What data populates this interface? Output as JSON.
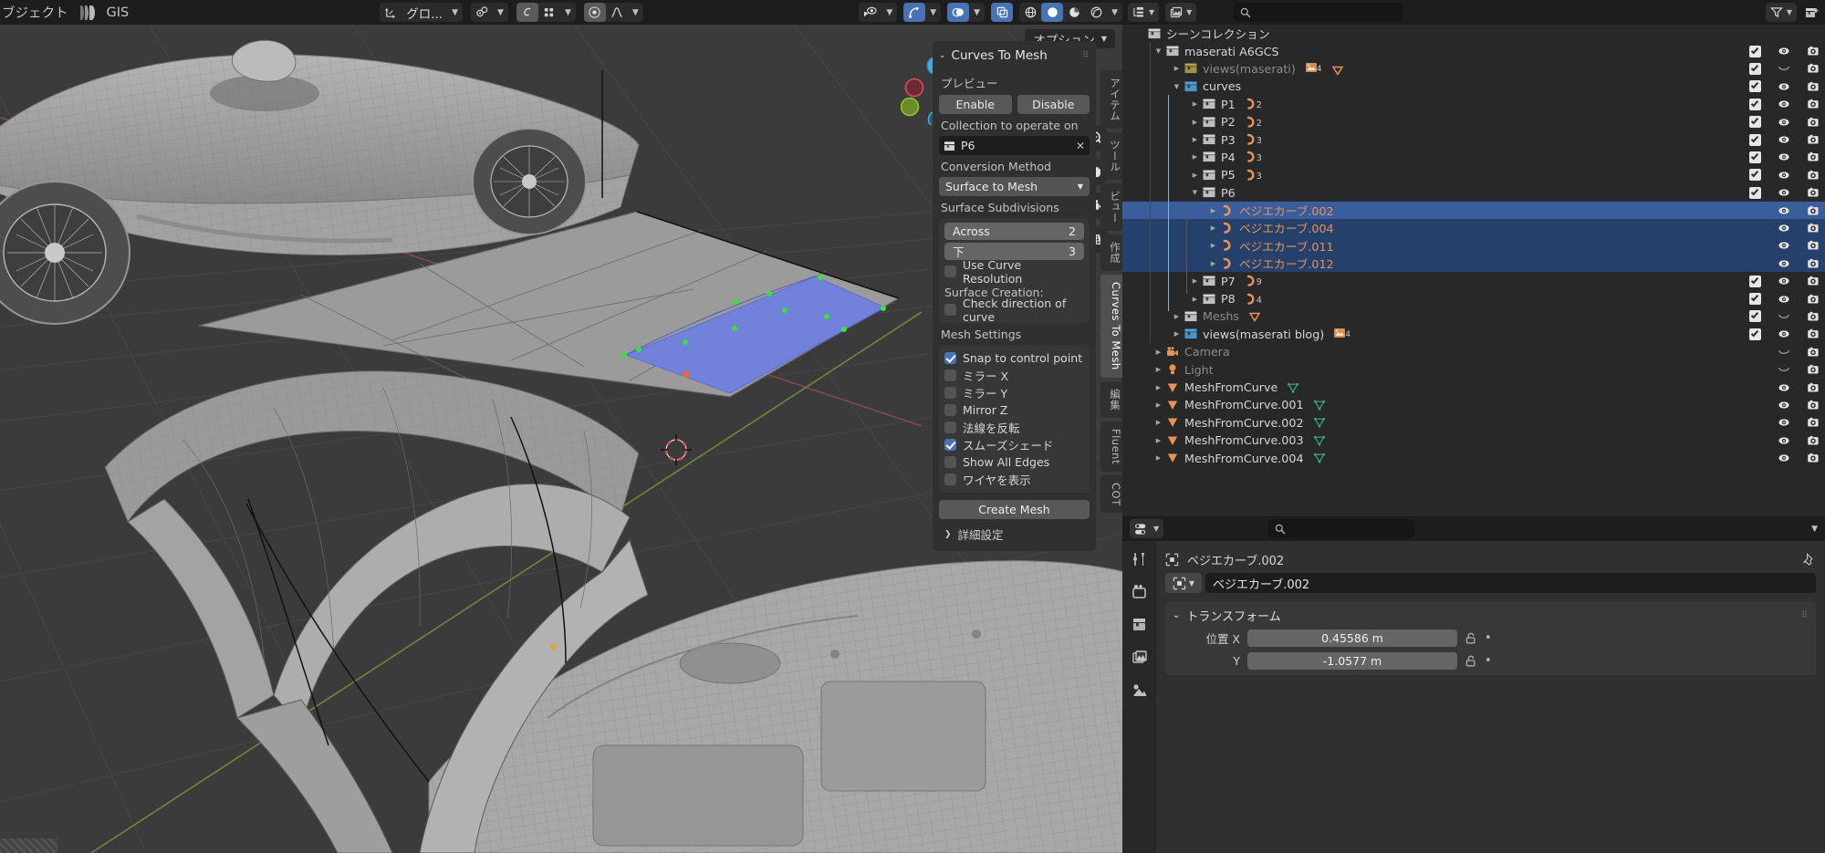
{
  "topbar": {
    "menu_object": "ブジェクト",
    "gis_label": "GIS",
    "transform_orientation": "グロ...",
    "options_label": "オプション"
  },
  "viewport": {
    "gizmo_axes": [
      "Z",
      "Y",
      "X"
    ],
    "tools": [
      "zoom-icon",
      "hand-icon",
      "camera-icon",
      "grid-icon"
    ]
  },
  "npanel": {
    "title": "Curves To Mesh",
    "preview_label": "プレビュー",
    "enable": "Enable",
    "disable": "Disable",
    "collection_label": "Collection to operate on",
    "collection_value": "P6",
    "conversion_label": "Conversion Method",
    "conversion_value": "Surface to Mesh",
    "subdiv_label": "Surface Subdivisions",
    "across_label": "Across",
    "across_value": "2",
    "down_label": "下",
    "down_value": "3",
    "use_curve_res": "Use Curve Resolution",
    "surface_creation_label": "Surface Creation:",
    "check_direction": "Check direction of curve",
    "mesh_settings_label": "Mesh Settings",
    "snap_control_point": "Snap to control point",
    "mirror_x": "ミラー X",
    "mirror_y": "ミラー Y",
    "mirror_z": "Mirror Z",
    "flip_normals": "法線を反転",
    "smooth_shade": "スムーズシェード",
    "show_all_edges": "Show All Edges",
    "show_wire": "ワイヤを表示",
    "create_mesh": "Create Mesh",
    "advanced": "詳細設定",
    "checks": {
      "use_curve_res": false,
      "check_direction": false,
      "snap_control_point": true,
      "mirror_x": false,
      "mirror_y": false,
      "mirror_z": false,
      "flip_normals": false,
      "smooth_shade": true,
      "show_all_edges": false,
      "show_wire": false
    }
  },
  "vtabs": [
    {
      "label": "アイテム",
      "active": false
    },
    {
      "label": "ツール",
      "active": false
    },
    {
      "label": "ビュー",
      "active": false
    },
    {
      "label": "作成",
      "active": false
    },
    {
      "label": "Curves To Mesh",
      "active": true
    },
    {
      "label": "編集",
      "active": false
    },
    {
      "label": "Fluent",
      "active": false
    },
    {
      "label": "COT",
      "active": false
    }
  ],
  "outliner": {
    "rows": [
      {
        "name": "シーンコレクション",
        "indent": 0,
        "tri": "",
        "icon": "collection",
        "icon_color": "#d3d3d3",
        "text_color": "normal",
        "check": null,
        "eye": null,
        "cam": null,
        "sel": false
      },
      {
        "name": "maserati A6GCS",
        "indent": 1,
        "tri": "down",
        "icon": "collection",
        "icon_color": "#d3d3d3",
        "text_color": "normal",
        "check": true,
        "eye": "open",
        "cam": true,
        "sel": false
      },
      {
        "name": "views(maserati)",
        "indent": 2,
        "tri": "right",
        "icon": "collection",
        "icon_color": "#b4a04a",
        "text_color": "dim",
        "check": true,
        "eye": "closed",
        "cam": true,
        "sel": false,
        "badges": [
          "image4",
          "mesh"
        ]
      },
      {
        "name": "curves",
        "indent": 2,
        "tri": "down",
        "icon": "collection",
        "icon_color": "#4aa5e0",
        "text_color": "normal",
        "check": true,
        "eye": "open",
        "cam": true,
        "sel": false
      },
      {
        "name": "P1",
        "indent": 3,
        "tri": "right",
        "icon": "collection",
        "icon_color": "#d3d3d3",
        "text_color": "normal",
        "check": true,
        "eye": "open",
        "cam": true,
        "sel": false,
        "curve_count": "2"
      },
      {
        "name": "P2",
        "indent": 3,
        "tri": "right",
        "icon": "collection",
        "icon_color": "#d3d3d3",
        "text_color": "normal",
        "check": true,
        "eye": "open",
        "cam": true,
        "sel": false,
        "curve_count": "2"
      },
      {
        "name": "P3",
        "indent": 3,
        "tri": "right",
        "icon": "collection",
        "icon_color": "#d3d3d3",
        "text_color": "normal",
        "check": true,
        "eye": "open",
        "cam": true,
        "sel": false,
        "curve_count": "3"
      },
      {
        "name": "P4",
        "indent": 3,
        "tri": "right",
        "icon": "collection",
        "icon_color": "#d3d3d3",
        "text_color": "normal",
        "check": true,
        "eye": "open",
        "cam": true,
        "sel": false,
        "curve_count": "3"
      },
      {
        "name": "P5",
        "indent": 3,
        "tri": "right",
        "icon": "collection",
        "icon_color": "#d3d3d3",
        "text_color": "normal",
        "check": true,
        "eye": "open",
        "cam": true,
        "sel": false,
        "curve_count": "3"
      },
      {
        "name": "P6",
        "indent": 3,
        "tri": "down",
        "icon": "collection",
        "icon_color": "#d3d3d3",
        "text_color": "normal",
        "check": true,
        "eye": "open",
        "cam": true,
        "sel": false
      },
      {
        "name": "ベジエカーブ.002",
        "indent": 4,
        "tri": "right",
        "icon": "curve",
        "icon_color": "#e79256",
        "text_color": "orange",
        "check": null,
        "eye": "open",
        "cam": true,
        "sel": "active"
      },
      {
        "name": "ベジエカーブ.004",
        "indent": 4,
        "tri": "right",
        "icon": "curve",
        "icon_color": "#e79256",
        "text_color": "orange",
        "check": null,
        "eye": "open",
        "cam": true,
        "sel": true
      },
      {
        "name": "ベジエカーブ.011",
        "indent": 4,
        "tri": "right",
        "icon": "curve",
        "icon_color": "#e79256",
        "text_color": "orange",
        "check": null,
        "eye": "open",
        "cam": true,
        "sel": true
      },
      {
        "name": "ベジエカーブ.012",
        "indent": 4,
        "tri": "right",
        "icon": "curve",
        "icon_color": "#e79256",
        "text_color": "orange",
        "check": null,
        "eye": "open",
        "cam": true,
        "sel": true
      },
      {
        "name": "P7",
        "indent": 3,
        "tri": "right",
        "icon": "collection",
        "icon_color": "#d3d3d3",
        "text_color": "normal",
        "check": true,
        "eye": "open",
        "cam": true,
        "sel": false,
        "curve_count": "9"
      },
      {
        "name": "P8",
        "indent": 3,
        "tri": "right",
        "icon": "collection",
        "icon_color": "#d3d3d3",
        "text_color": "normal",
        "check": true,
        "eye": "open",
        "cam": true,
        "sel": false,
        "curve_count": "4"
      },
      {
        "name": "Meshs",
        "indent": 2,
        "tri": "right",
        "icon": "collection",
        "icon_color": "#a munched",
        "text_color": "dim",
        "check": true,
        "eye": "closed",
        "cam": true,
        "sel": false,
        "badges": [
          "mesh"
        ]
      },
      {
        "name": "views(maserati blog)",
        "indent": 2,
        "tri": "right",
        "icon": "collection",
        "icon_color": "#4aa5e0",
        "text_color": "normal",
        "check": true,
        "eye": "open",
        "cam": true,
        "sel": false,
        "badges": [
          "image4"
        ]
      },
      {
        "name": "Camera",
        "indent": 1,
        "tri": "right",
        "icon": "camera",
        "icon_color": "#e79256",
        "text_color": "dim",
        "check": null,
        "eye": "closed",
        "cam": true,
        "sel": false
      },
      {
        "name": "Light",
        "indent": 1,
        "tri": "right",
        "icon": "light",
        "icon_color": "#e79256",
        "text_color": "dim",
        "check": null,
        "eye": "closed",
        "cam": true,
        "sel": false
      },
      {
        "name": "MeshFromCurve",
        "indent": 1,
        "tri": "right",
        "icon": "mesh",
        "icon_color": "#e79256",
        "text_color": "normal",
        "check": null,
        "eye": "open",
        "cam": true,
        "sel": false,
        "badges": [
          "meshdata"
        ]
      },
      {
        "name": "MeshFromCurve.001",
        "indent": 1,
        "tri": "right",
        "icon": "mesh",
        "icon_color": "#e79256",
        "text_color": "normal",
        "check": null,
        "eye": "open",
        "cam": true,
        "sel": false,
        "badges": [
          "meshdata"
        ]
      },
      {
        "name": "MeshFromCurve.002",
        "indent": 1,
        "tri": "right",
        "icon": "mesh",
        "icon_color": "#e79256",
        "text_color": "normal",
        "check": null,
        "eye": "open",
        "cam": true,
        "sel": false,
        "badges": [
          "meshdata"
        ]
      },
      {
        "name": "MeshFromCurve.003",
        "indent": 1,
        "tri": "right",
        "icon": "mesh",
        "icon_color": "#e79256",
        "text_color": "normal",
        "check": null,
        "eye": "open",
        "cam": true,
        "sel": false,
        "badges": [
          "meshdata"
        ]
      },
      {
        "name": "MeshFromCurve.004",
        "indent": 1,
        "tri": "right",
        "icon": "mesh",
        "icon_color": "#e79256",
        "text_color": "normal",
        "check": null,
        "eye": "open",
        "cam": true,
        "sel": false,
        "badges": [
          "meshdata"
        ]
      }
    ]
  },
  "properties": {
    "breadcrumb_name": "ベジエカーブ.002",
    "object_name": "ベジエカーブ.002",
    "transform_title": "トランスフォーム",
    "fields": [
      {
        "label": "位置 X",
        "value": "0.45586 m"
      },
      {
        "label": "Y",
        "value": "-1.0577 m"
      }
    ]
  },
  "colors": {
    "accent_blue": "#4772b3",
    "selection_blue": "#25406b",
    "active_blue": "#3a5e9c",
    "curve_orange": "#e79256",
    "mesh_green": "#3aab7e",
    "viewport_bg": "#3b3b3b",
    "surface_blue": "#6f7fe0"
  }
}
